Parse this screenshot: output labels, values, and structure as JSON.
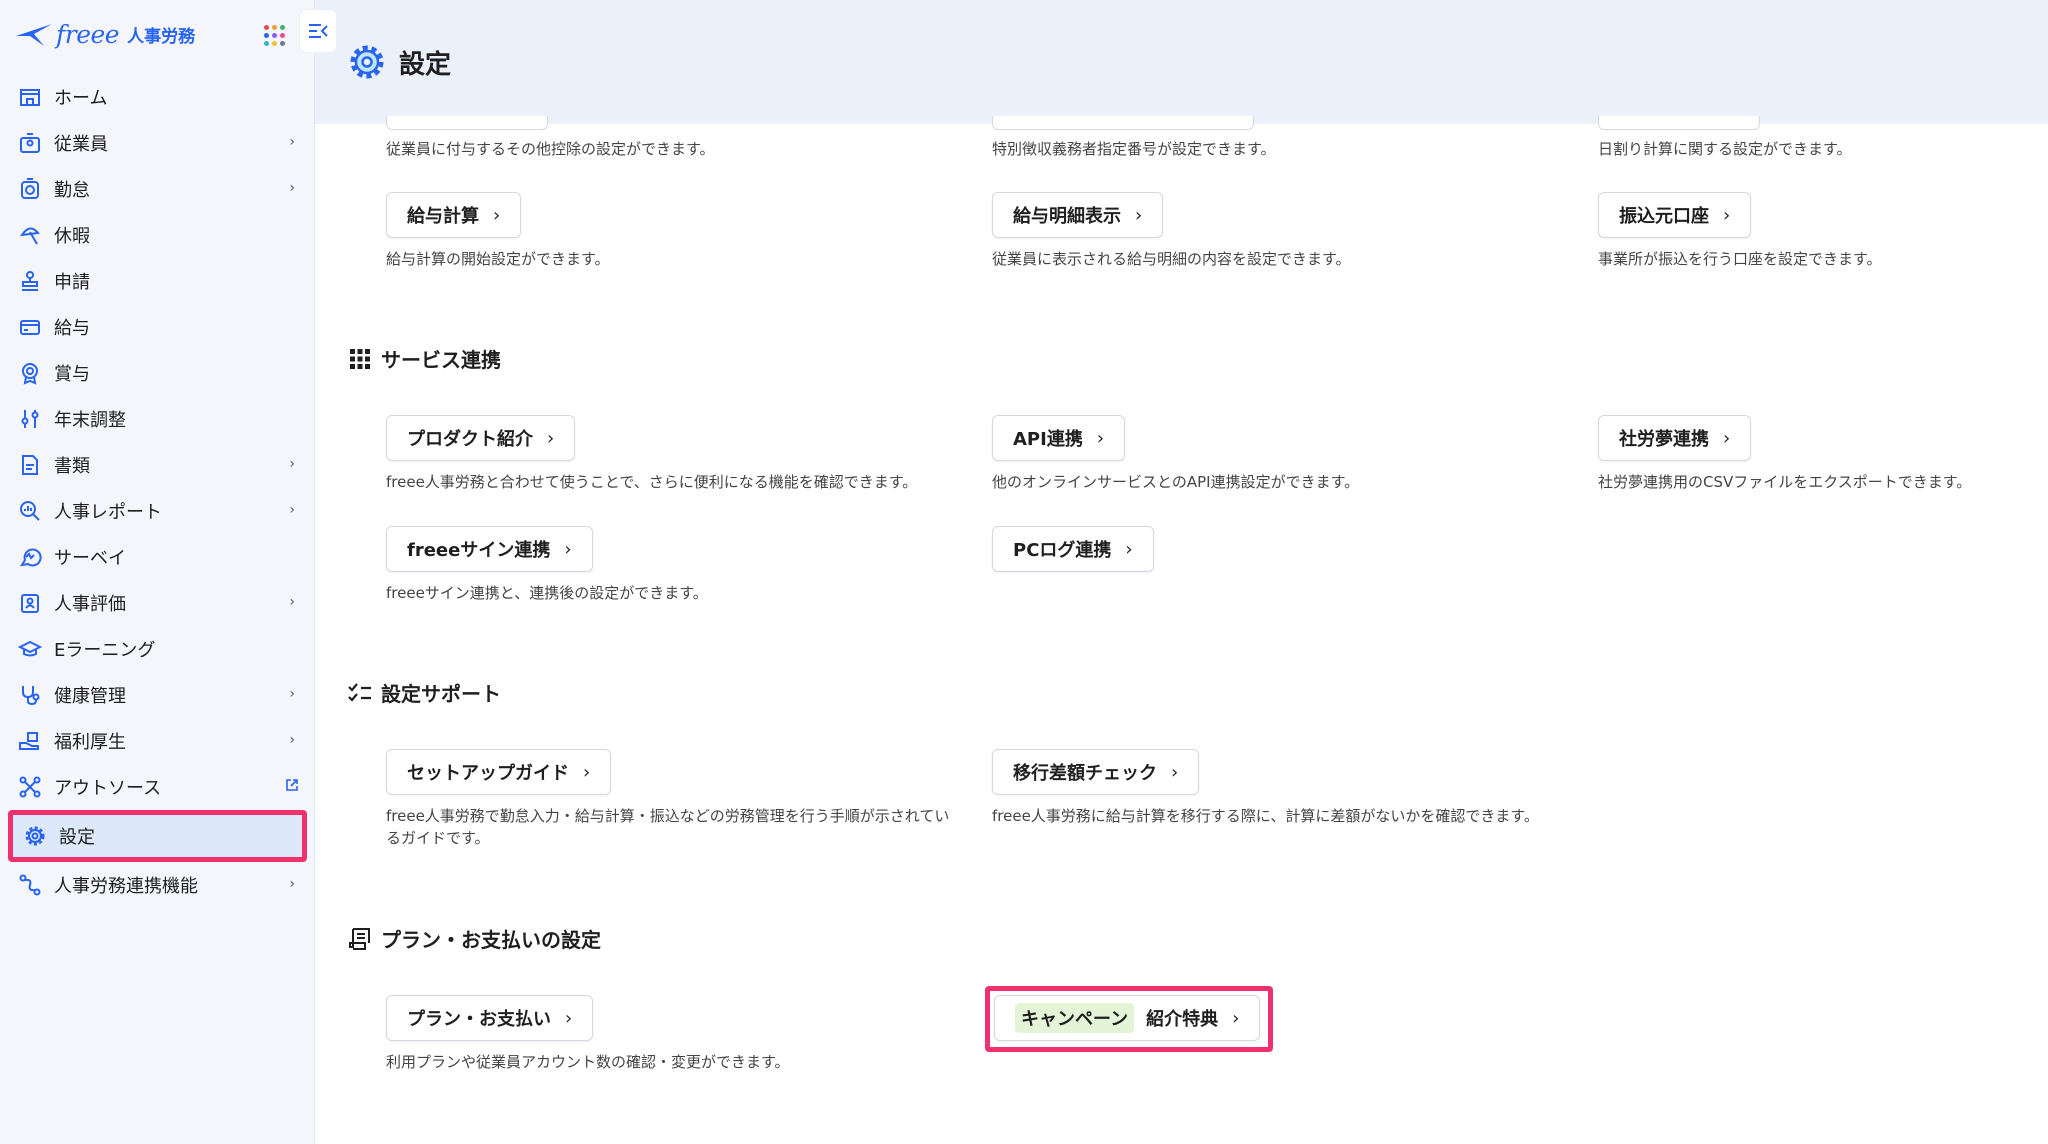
{
  "brand": {
    "name": "freee",
    "product": "人事労務"
  },
  "sidebar": {
    "items": [
      {
        "label": "ホーム",
        "icon": "home-icon"
      },
      {
        "label": "従業員",
        "icon": "employee-icon",
        "chevron": "›"
      },
      {
        "label": "勤怠",
        "icon": "attendance-icon",
        "chevron": "›"
      },
      {
        "label": "休暇",
        "icon": "vacation-icon"
      },
      {
        "label": "申請",
        "icon": "stamp-icon"
      },
      {
        "label": "給与",
        "icon": "payroll-icon"
      },
      {
        "label": "賞与",
        "icon": "bonus-icon"
      },
      {
        "label": "年末調整",
        "icon": "adjust-icon"
      },
      {
        "label": "書類",
        "icon": "document-icon",
        "chevron": "›"
      },
      {
        "label": "人事レポート",
        "icon": "report-icon",
        "chevron": "›"
      },
      {
        "label": "サーベイ",
        "icon": "survey-icon"
      },
      {
        "label": "人事評価",
        "icon": "evaluation-icon",
        "chevron": "›"
      },
      {
        "label": "Eラーニング",
        "icon": "elearning-icon"
      },
      {
        "label": "健康管理",
        "icon": "health-icon",
        "chevron": "›"
      },
      {
        "label": "福利厚生",
        "icon": "welfare-icon",
        "chevron": "›"
      },
      {
        "label": "アウトソース",
        "icon": "outsource-icon",
        "external": true
      },
      {
        "label": "設定",
        "icon": "gear-icon",
        "active": true
      },
      {
        "label": "人事労務連携機能",
        "icon": "link-icon",
        "chevron": "›"
      }
    ]
  },
  "header": {
    "title": "設定"
  },
  "top_rows": {
    "descs": [
      "従業員に付与するその他控除の設定ができます。",
      "特別徴収義務者指定番号が設定できます。",
      "日割り計算に関する設定ができます。"
    ],
    "buttons": [
      {
        "label": "給与計算",
        "desc": "給与計算の開始設定ができます。"
      },
      {
        "label": "給与明細表示",
        "desc": "従業員に表示される給与明細の内容を設定できます。"
      },
      {
        "label": "振込元口座",
        "desc": "事業所が振込を行う口座を設定できます。"
      }
    ]
  },
  "service": {
    "title": "サービス連携",
    "buttons": [
      {
        "label": "プロダクト紹介",
        "desc": "freee人事労務と合わせて使うことで、さらに便利になる機能を確認できます。"
      },
      {
        "label": "API連携",
        "desc": "他のオンラインサービスとのAPI連携設定ができます。"
      },
      {
        "label": "社労夢連携",
        "desc": "社労夢連携用のCSVファイルをエクスポートできます。"
      },
      {
        "label": "freeeサイン連携",
        "desc": "freeeサイン連携と、連携後の設定ができます。"
      },
      {
        "label": "PCログ連携",
        "desc": ""
      }
    ]
  },
  "support": {
    "title": "設定サポート",
    "buttons": [
      {
        "label": "セットアップガイド",
        "desc1": "freee人事労務で勤怠入力・給与計算・振込などの労務管理を行う手順が示されてい",
        "desc2": "るガイドです。"
      },
      {
        "label": "移行差額チェック",
        "desc1": "freee人事労務に給与計算を移行する際に、計算に差額がないかを確認できます。"
      }
    ]
  },
  "plan": {
    "title": "プラン・お支払いの設定",
    "buttons": [
      {
        "label": "プラン・お支払い",
        "desc": "利用プランや従業員アカウント数の確認・変更ができます。"
      },
      {
        "badge": "キャンペーン",
        "label": "紹介特典"
      }
    ]
  },
  "chevron": "›",
  "colors": {
    "accent": "#2864f0",
    "highlight": "#f0316b",
    "badge_bg": "#e3f5d6",
    "header_bg": "#eaf1fb"
  }
}
